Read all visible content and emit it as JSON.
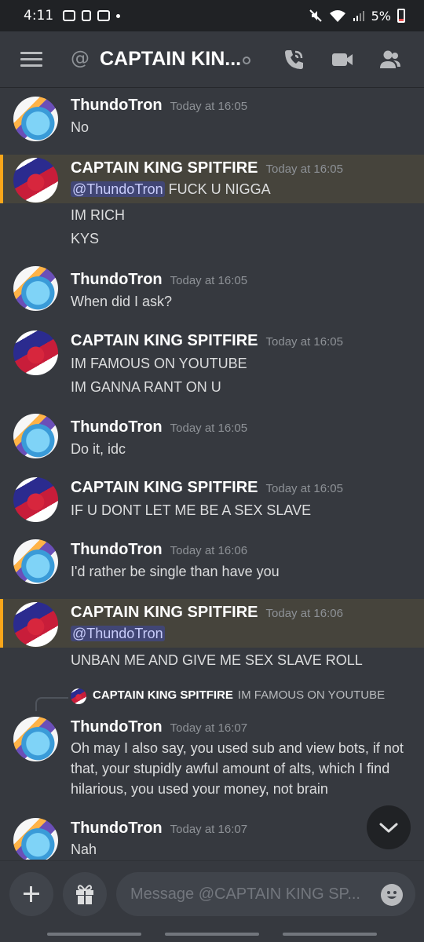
{
  "status_bar": {
    "time": "4:11",
    "battery": "5%"
  },
  "header": {
    "title": "CAPTAIN KIN..."
  },
  "messages": [
    {
      "author": "ThundoTron",
      "time": "Today at 16:05",
      "lines": [
        "No"
      ]
    },
    {
      "author": "CAPTAIN KING SPITFIRE",
      "time": "Today at 16:05",
      "mention": "@ThundoTron",
      "lines": [
        " FUCK U NIGGA",
        "IM RICH",
        "KYS"
      ]
    },
    {
      "author": "ThundoTron",
      "time": "Today at 16:05",
      "lines": [
        "When did I ask?"
      ]
    },
    {
      "author": "CAPTAIN KING SPITFIRE",
      "time": "Today at 16:05",
      "lines": [
        "IM FAMOUS ON YOUTUBE",
        "IM GANNA RANT ON U"
      ]
    },
    {
      "author": "ThundoTron",
      "time": "Today at 16:05",
      "lines": [
        "Do it, idc"
      ]
    },
    {
      "author": "CAPTAIN KING SPITFIRE",
      "time": "Today at 16:05",
      "lines": [
        "IF U DONT LET ME BE A SEX SLAVE"
      ]
    },
    {
      "author": "ThundoTron",
      "time": "Today at 16:06",
      "lines": [
        "I'd rather be single than have you"
      ]
    },
    {
      "author": "CAPTAIN KING SPITFIRE",
      "time": "Today at 16:06",
      "mention": "@ThundoTron",
      "lines": [
        "UNBAN ME AND GIVE ME SEX SLAVE ROLL"
      ]
    },
    {
      "author": "ThundoTron",
      "time": "Today at 16:07",
      "reply_to": {
        "author": "CAPTAIN KING SPITFIRE",
        "content": "IM FAMOUS ON YOUTUBE"
      },
      "lines": [
        "Oh may I also say, you used sub and view bots, if not",
        "that, your stupidly awful amount of alts, which I find",
        "hilarious, you used your money, not brain"
      ]
    },
    {
      "author": "ThundoTron",
      "time": "Today at 16:07",
      "lines": [
        "Nah"
      ]
    }
  ],
  "composer": {
    "placeholder": "Message @CAPTAIN KING SP..."
  },
  "icons": [
    "menu-icon",
    "at-icon",
    "call-icon",
    "video-icon",
    "members-icon",
    "plus-icon",
    "gift-icon",
    "emoji-icon",
    "chevron-down-icon"
  ]
}
